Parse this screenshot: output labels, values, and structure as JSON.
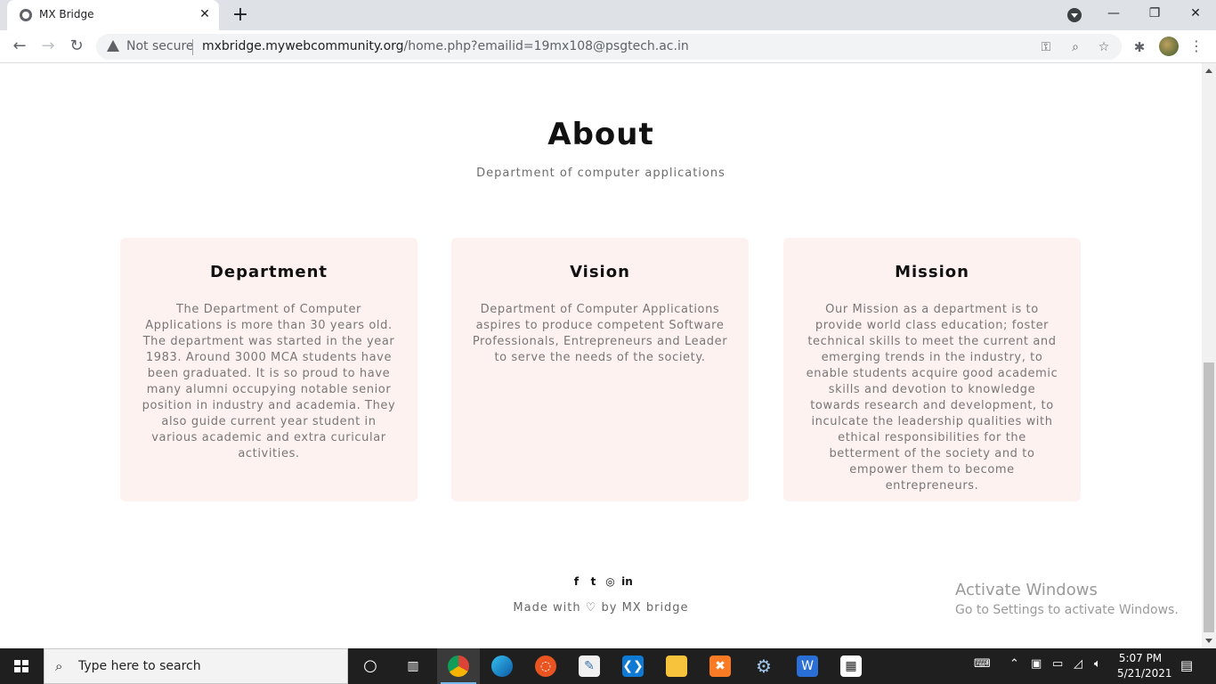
{
  "browser": {
    "tab_title": "MX Bridge",
    "not_secure": "Not secure",
    "url_domain": "mxbridge.mywebcommunity.org",
    "url_path": "/home.php?emailid=19mx108@psgtech.ac.in"
  },
  "page": {
    "about_title": "About",
    "about_subtitle": "Department of computer applications",
    "cards": [
      {
        "title": "Department",
        "body": "The Department of Computer Applications is more than 30 years old. The department was started in the year 1983. Around 3000 MCA students have been graduated. It is so proud to have many alumni occupying notable senior position in industry and academia. They also guide current year student in various academic and extra curicular activities."
      },
      {
        "title": "Vision",
        "body": "Department of Computer Applications aspires to produce competent Software Professionals, Entrepreneurs and Leader to serve the needs of the society."
      },
      {
        "title": "Mission",
        "body": "Our Mission as a department is to provide world class education; foster technical skills to meet the current and emerging trends in the industry, to enable students acquire good academic skills and devotion to knowledge towards research and development, to inculcate the leadership qualities with ethical responsibilities for the betterment of the society and to empower them to become entrepreneurs."
      }
    ],
    "social_icons": [
      "facebook-icon",
      "twitter-icon",
      "instagram-icon",
      "linkedin-icon"
    ],
    "footer_made_with": "Made with",
    "footer_by": "by MX bridge"
  },
  "overlay": {
    "activate_title": "Activate Windows",
    "activate_sub": "Go to Settings to activate Windows."
  },
  "taskbar": {
    "search_placeholder": "Type here to search",
    "time": "5:07 PM",
    "date": "5/21/2021"
  }
}
